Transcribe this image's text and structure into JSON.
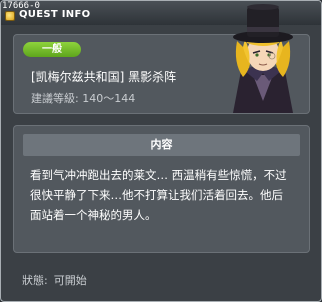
{
  "window": {
    "quest_id": "17666-0",
    "title": "QUEST INFO"
  },
  "quest": {
    "category": "一般",
    "name": "[凯梅尔兹共和国] 黑影杀阵",
    "level": "建議等級: 140～144"
  },
  "content": {
    "header": "内容",
    "lines": [
      "看到气冲冲跑出去的莱文… 西温稍有些惊慌，不过",
      "很快平静了下来…他不打算让我们活着回去。他后",
      "面站着一个神秘的男人。"
    ]
  },
  "status": {
    "label": "狀態:",
    "value": "可開始"
  },
  "npc": {
    "icon": "npc-portrait-top-hat-man"
  }
}
